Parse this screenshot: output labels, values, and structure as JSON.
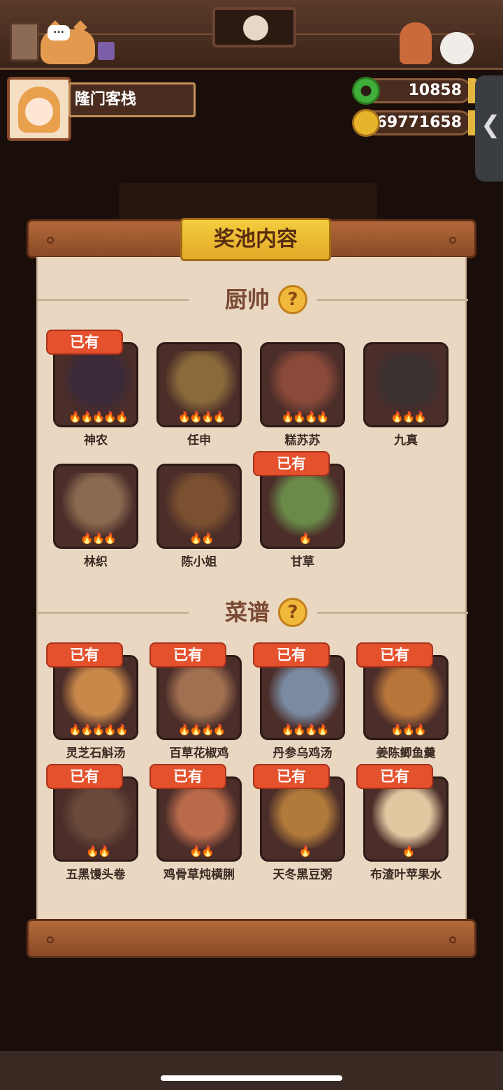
{
  "header": {
    "restaurant_name": "隆门客栈",
    "jade_amount": "10858",
    "coin_amount": "69771658",
    "bubble_text": "...",
    "side_tab_icon": "chevron-left-icon"
  },
  "pool": {
    "title": "奖池内容",
    "owned_label": "已有",
    "flame_icon": "flame-icon",
    "chef_section": {
      "label": "厨帅",
      "help": "?",
      "items": [
        {
          "name": "神农",
          "flames": "🔥🔥🔥🔥🔥",
          "owned": true,
          "color": "#3a2a3a"
        },
        {
          "name": "任申",
          "flames": "🔥🔥🔥🔥",
          "owned": false,
          "color": "#8a6a3a"
        },
        {
          "name": "糕苏苏",
          "flames": "🔥🔥🔥🔥",
          "owned": false,
          "color": "#8a4a3a"
        },
        {
          "name": "九真",
          "flames": "🔥🔥🔥",
          "owned": false,
          "color": "#3a3030"
        },
        {
          "name": "林织",
          "flames": "🔥🔥🔥",
          "owned": false,
          "color": "#8a6a50"
        },
        {
          "name": "陈小姐",
          "flames": "🔥🔥",
          "owned": false,
          "color": "#7a5030"
        },
        {
          "name": "甘草",
          "flames": "🔥",
          "owned": true,
          "color": "#6a8a4a"
        }
      ]
    },
    "recipe_section": {
      "label": "菜谱",
      "help": "?",
      "items": [
        {
          "name": "灵芝石斛汤",
          "flames": "🔥🔥🔥🔥🔥",
          "owned": true,
          "color": "#c9884a"
        },
        {
          "name": "百草花椒鸡",
          "flames": "🔥🔥🔥🔥",
          "owned": true,
          "color": "#a07050"
        },
        {
          "name": "丹参乌鸡汤",
          "flames": "🔥🔥🔥🔥",
          "owned": true,
          "color": "#7a8aa0"
        },
        {
          "name": "姜陈鲫鱼羹",
          "flames": "🔥🔥🔥",
          "owned": true,
          "color": "#b8753a"
        },
        {
          "name": "五黑馒头卷",
          "flames": "🔥🔥",
          "owned": true,
          "color": "#6a4a3a"
        },
        {
          "name": "鸡骨草炖横脷",
          "flames": "🔥🔥",
          "owned": true,
          "color": "#b86a4a"
        },
        {
          "name": "天冬黑豆粥",
          "flames": "🔥",
          "owned": true,
          "color": "#b07a3a"
        },
        {
          "name": "布渣叶苹果水",
          "flames": "🔥",
          "owned": true,
          "color": "#e0c8a0"
        }
      ]
    }
  }
}
